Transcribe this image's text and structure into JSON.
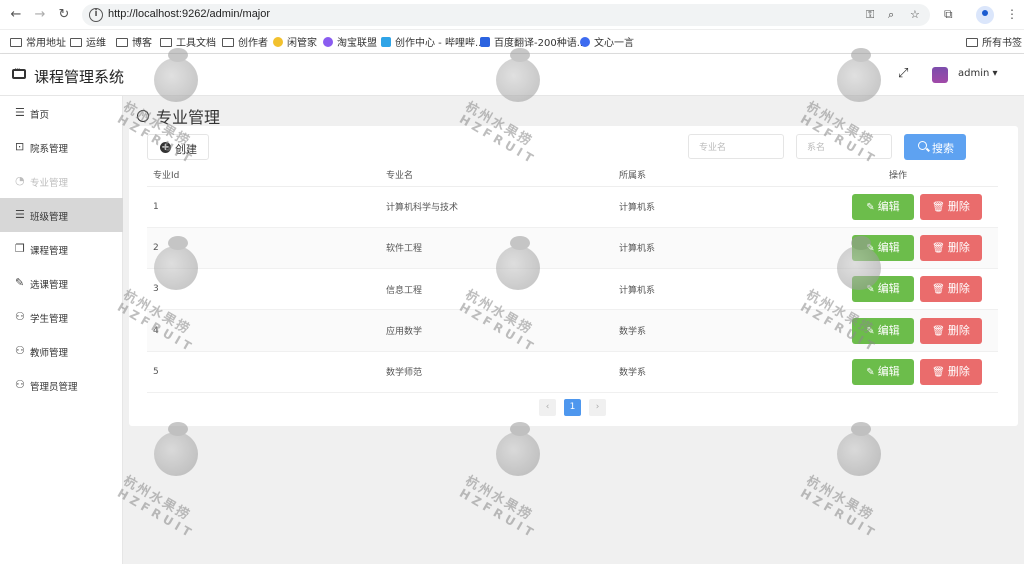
{
  "browser": {
    "url": "http://localhost:9262/admin/major",
    "bookmarks": [
      "常用地址",
      "运维",
      "博客",
      "工具文档",
      "创作者",
      "闲管家",
      "淘宝联盟",
      "创作中心 - 哔哩哔...",
      "百度翻译-200种语...",
      "文心一言"
    ],
    "all_bookmarks": "所有书签"
  },
  "app": {
    "title": "课程管理系统",
    "user": "admin"
  },
  "sidebar": {
    "items": [
      {
        "label": "首页",
        "icon": "menu-lines-icon",
        "state": "normal"
      },
      {
        "label": "院系管理",
        "icon": "dots-box-icon",
        "state": "normal"
      },
      {
        "label": "专业管理",
        "icon": "pie-chart-icon",
        "state": "disabled"
      },
      {
        "label": "班级管理",
        "icon": "menu-lines-icon",
        "state": "active"
      },
      {
        "label": "课程管理",
        "icon": "copy-icon",
        "state": "normal"
      },
      {
        "label": "选课管理",
        "icon": "pencil-icon",
        "state": "normal"
      },
      {
        "label": "学生管理",
        "icon": "user-icon",
        "state": "normal"
      },
      {
        "label": "教师管理",
        "icon": "user-icon",
        "state": "normal"
      },
      {
        "label": "管理员管理",
        "icon": "user-icon",
        "state": "normal"
      }
    ]
  },
  "page": {
    "title": "专业管理",
    "create_label": "创建",
    "search_major_placeholder": "专业名",
    "search_dept_placeholder": "系名",
    "search_label": "搜索"
  },
  "table": {
    "headers": [
      "专业Id",
      "专业名",
      "所属系",
      "操作"
    ],
    "rows": [
      {
        "id": "1",
        "name": "计算机科学与技术",
        "dept": "计算机系"
      },
      {
        "id": "2",
        "name": "软件工程",
        "dept": "计算机系"
      },
      {
        "id": "3",
        "name": "信息工程",
        "dept": "计算机系"
      },
      {
        "id": "4",
        "name": "应用数学",
        "dept": "数学系"
      },
      {
        "id": "5",
        "name": "数学师范",
        "dept": "数学系"
      }
    ],
    "edit_label": "编辑",
    "delete_label": "删除"
  },
  "pagination": {
    "prev": "‹",
    "current": "1",
    "next": "›"
  },
  "watermark": {
    "line1": "杭州水果捞",
    "line2": "HZFRUIT"
  },
  "colors": {
    "search_button": "#5ea2f1",
    "edit_button": "#6cbd4b",
    "delete_button": "#ea6c6c",
    "active_menu": "#d7d7d7",
    "current_page": "#4e97ee"
  }
}
